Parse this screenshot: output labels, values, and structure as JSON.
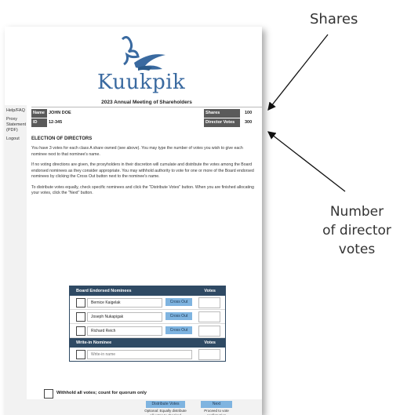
{
  "annotations": {
    "shares_label": "Shares",
    "votes_label_1": "Number",
    "votes_label_2": "of director",
    "votes_label_3": "votes"
  },
  "logo": {
    "text": "Kuukpik"
  },
  "sidebar": {
    "items": [
      "Help/FAQ",
      "Proxy Statement (PDF)",
      "Logout"
    ]
  },
  "meeting_title": "2023 Annual Meeting of Shareholders",
  "shareholder": {
    "name_label": "Name",
    "name_value": "JOHN DOE",
    "id_label": "ID",
    "id_value": "12-345",
    "shares_label": "Shares",
    "shares_value": "100",
    "director_votes_label": "Director Votes",
    "director_votes_value": "300"
  },
  "election": {
    "title": "ELECTION OF DIRECTORS",
    "para1": "You have 3 votes for each class A share owned (see above). You may type the number of votes you wish to give each nominee next to that nominee's name.",
    "para2": "If no voting directions are given, the proxyholders in their discretion will cumulate and distribute the votes among the Board endorsed nominees as they consider appropriate. You may withhold authority to vote for one or more of the Board endorsed nominees by clicking the Cross Out button next to the nominee's name.",
    "para3": "To distribute votes equally, check specific nominees and click the \"Distribute Votes\" button. When you are finished allocating your votes, click the \"Next\" button."
  },
  "ballot": {
    "board_header": "Board Endorsed Nominees",
    "votes_header": "Votes",
    "nominees": [
      {
        "name": "Bernice Kaigelak",
        "cross_out": "Cross Out"
      },
      {
        "name": "Joseph Nukapigak",
        "cross_out": "Cross Out"
      },
      {
        "name": "Richard Reich",
        "cross_out": "Cross Out"
      }
    ],
    "writein_header": "Write-in Nominee",
    "writein_votes_header": "Votes",
    "writein_placeholder": "Write-in name"
  },
  "withhold_label": "Withhold all votes; count for quorum only",
  "actions": {
    "distribute_label": "Distribute Votes",
    "distribute_note": "Optional: Equally distribute all votes to checked candidates",
    "next_label": "Next",
    "next_note": "Proceed to vote confirmation"
  }
}
